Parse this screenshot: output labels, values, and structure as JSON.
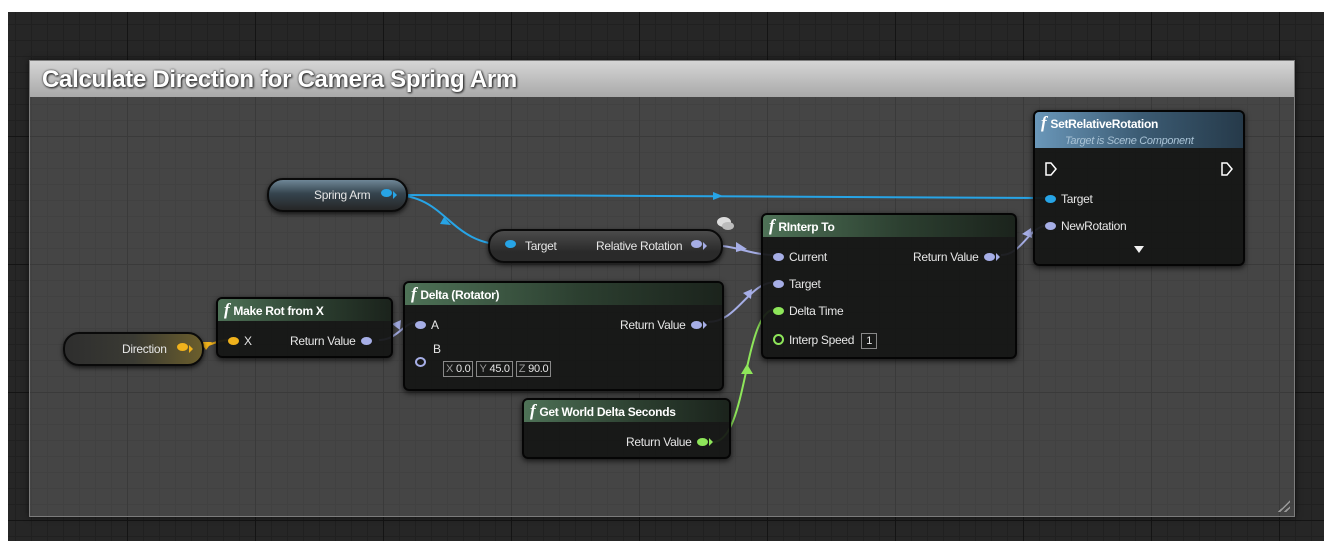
{
  "comment": {
    "title": "Calculate Direction for Camera Spring Arm"
  },
  "nodes": {
    "spring_arm": {
      "label": "Spring Arm"
    },
    "direction": {
      "label": "Direction"
    },
    "relative_rotation": {
      "input_label": "Target",
      "output_label": "Relative Rotation"
    },
    "make_rot": {
      "title": "Make Rot from X",
      "input_x": "X",
      "output": "Return Value"
    },
    "delta": {
      "title": "Delta (Rotator)",
      "input_a": "A",
      "input_b": "B",
      "output": "Return Value",
      "b_default": {
        "x_label": "X",
        "x": "0.0",
        "y_label": "Y",
        "y": "45.0",
        "z_label": "Z",
        "z": "90.0"
      }
    },
    "rinterp": {
      "title": "RInterp To",
      "current": "Current",
      "target": "Target",
      "delta_time": "Delta Time",
      "interp_speed": "Interp Speed",
      "interp_speed_value": "1",
      "output": "Return Value"
    },
    "world_delta": {
      "title": "Get World Delta Seconds",
      "output": "Return Value"
    },
    "set_rel_rot": {
      "title": "SetRelativeRotation",
      "subtitle": "Target is Scene Component",
      "target": "Target",
      "new_rotation": "NewRotation"
    }
  },
  "pin_colors": {
    "object": "#27a4e6",
    "rotator": "#a6aee6",
    "vector": "#f0b21c",
    "float": "#8ee65a",
    "exec": "#ffffff"
  },
  "icons": {
    "function": "function-icon",
    "exec": "exec-pin-icon",
    "advanced": "expand-arrow-icon",
    "resize": "resize-grip-icon"
  }
}
